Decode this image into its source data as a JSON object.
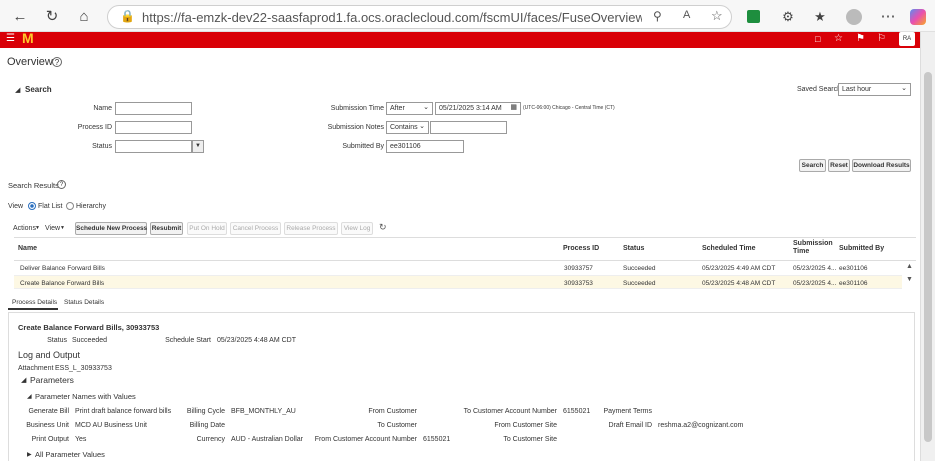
{
  "browser": {
    "url": "https://fa-emzk-dev22-saasfaprod1.fa.ocs.oraclecloud.com/fscmUI/faces/FuseOverview?fnd=%3B%3B%3B%...",
    "avatar": "RA"
  },
  "page": {
    "title": "Overview"
  },
  "search": {
    "heading": "Search",
    "saved_search_label": "Saved Search",
    "saved_search_value": "Last hour",
    "name_label": "Name",
    "name_value": "",
    "process_id_label": "Process ID",
    "process_id_value": "",
    "status_label": "Status",
    "status_value": "",
    "submission_time_label": "Submission Time",
    "submission_time_op": "After",
    "submission_time_value": "05/21/2025 3:14 AM",
    "timezone": "(UTC-06:00) Chicago - Central Time (CT)",
    "submission_notes_label": "Submission Notes",
    "submission_notes_op": "Contains",
    "submission_notes_value": "",
    "submitted_by_label": "Submitted By",
    "submitted_by_value": "ee301106",
    "search_button": "Search",
    "reset_button": "Reset",
    "download_button": "Download Results"
  },
  "results": {
    "heading": "Search Results",
    "view_label": "View",
    "flat_list": "Flat List",
    "hierarchy": "Hierarchy",
    "toolbar": {
      "actions": "Actions",
      "view": "View",
      "schedule": "Schedule New Process",
      "resubmit": "Resubmit",
      "put_on_hold": "Put On Hold",
      "cancel": "Cancel Process",
      "release": "Release Process",
      "view_log": "View Log"
    },
    "columns": [
      "Name",
      "Process ID",
      "Status",
      "Scheduled Time",
      "Submission Time",
      "Submitted By"
    ],
    "rows": [
      {
        "name": "Deliver Balance Forward Bills",
        "process_id": "30933757",
        "status": "Succeeded",
        "scheduled": "05/23/2025 4:49 AM CDT",
        "submission": "05/23/2025 4...",
        "submitted_by": "ee301106"
      },
      {
        "name": "Create Balance Forward Bills",
        "process_id": "30933753",
        "status": "Succeeded",
        "scheduled": "05/23/2025 4:48 AM CDT",
        "submission": "05/23/2025 4...",
        "submitted_by": "ee301106"
      }
    ]
  },
  "details": {
    "tab_process": "Process Details",
    "tab_status": "Status Details",
    "title": "Create Balance Forward Bills, 30933753",
    "status_label": "Status",
    "status_value": "Succeeded",
    "schedule_start_label": "Schedule Start",
    "schedule_start_value": "05/23/2025 4:48 AM CDT",
    "log_heading": "Log and Output",
    "attachment_label": "Attachment",
    "attachment_value": "ESS_L_30933753",
    "parameters_heading": "Parameters",
    "param_names_heading": "Parameter Names with Values",
    "all_params": "All Parameter Values",
    "params": {
      "generate_bill_label": "Generate Bill",
      "generate_bill_value": "Print draft balance forward bills",
      "business_unit_label": "Business Unit",
      "business_unit_value": "MCD AU Business Unit",
      "print_output_label": "Print Output",
      "print_output_value": "Yes",
      "billing_cycle_label": "Billing Cycle",
      "billing_cycle_value": "BFB_MONTHLY_AU",
      "billing_date_label": "Billing Date",
      "billing_date_value": "",
      "currency_label": "Currency",
      "currency_value": "AUD - Australian Dollar",
      "from_customer_label": "From Customer",
      "to_customer_label": "To Customer",
      "from_acct_label": "From Customer Account Number",
      "from_acct_value": "6155021",
      "to_acct_label": "To Customer Account Number",
      "to_acct_value": "6155021",
      "from_site_label": "From Customer Site",
      "to_site_label": "To Customer Site",
      "payment_terms_label": "Payment Terms",
      "draft_email_label": "Draft Email ID",
      "draft_email_value": "reshma.a2@cognizant.com"
    }
  }
}
